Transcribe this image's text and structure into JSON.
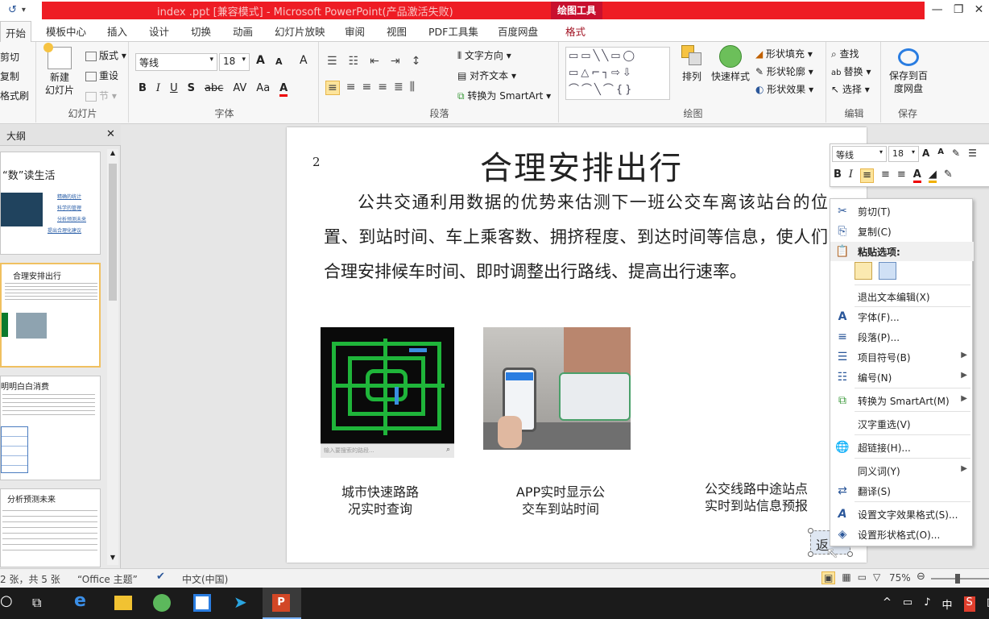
{
  "window": {
    "title": "index .ppt [兼容模式] - Microsoft PowerPoint(产品激活失败)",
    "tools_context": "绘图工具",
    "min": "—",
    "restore": "❐",
    "close": "✕"
  },
  "tabs": [
    "开始",
    "模板中心",
    "插入",
    "设计",
    "切换",
    "动画",
    "幻灯片放映",
    "审阅",
    "视图",
    "PDF工具集",
    "百度网盘",
    "格式"
  ],
  "ribbon": {
    "clipboard": {
      "cut": "剪切",
      "copy": "复制",
      "format_painter": "格式刷"
    },
    "slides": {
      "new_slide": "新建\n幻灯片",
      "layout": "版式",
      "reset": "重设",
      "section": "节",
      "label": "幻灯片"
    },
    "font": {
      "name": "等线",
      "size": "18",
      "label": "字体",
      "grow": "A",
      "shrink": "A",
      "clear": "A"
    },
    "paragraph": {
      "text_direction": "文字方向",
      "align_text": "对齐文本",
      "smartart": "转换为 SmartArt",
      "label": "段落"
    },
    "drawing": {
      "arrange": "排列",
      "quick_styles": "快速样式",
      "shape_fill": "形状填充",
      "shape_outline": "形状轮廓",
      "shape_effects": "形状效果",
      "label": "绘图"
    },
    "editing": {
      "find": "查找",
      "replace": "替换",
      "select": "选择",
      "label": "编辑"
    },
    "save": {
      "save_to_baidu": "保存到百\n度网盘",
      "label": "保存"
    }
  },
  "outline": {
    "tab_outline": "大纲",
    "close": "✕",
    "thumbs": [
      {
        "title": "“数”读生活",
        "lines": [
          "精确的统计",
          "科学的管理",
          "分析预测未来",
          "提出合理化建议"
        ]
      },
      {
        "title": "合理安排出行"
      },
      {
        "title": "明明白白消费"
      },
      {
        "title": "分析预测未来"
      }
    ]
  },
  "slide": {
    "number": "2",
    "title": "合理安排出行",
    "body": "公共交通利用数据的优势来估测下一班公交车离该站台的位置、到站时间、车上乘客数、拥挤程度、到达时间等信息，使人们合理安排候车时间、即时调整出行路线、提高出行速率。",
    "map_search_placeholder": "输入要搜索的路段...",
    "caption1": "城市快速路路\n况实时查询",
    "caption2": "APP实时显示公\n交车到站时间",
    "caption3": "公交线路中途站点\n实时到站信息预报",
    "back_button": "返"
  },
  "mini_toolbar": {
    "font": "等线",
    "size": "18"
  },
  "context_menu": {
    "items": [
      {
        "icon": "scissors-icon",
        "glyph": "✂",
        "label": "剪切(T)"
      },
      {
        "icon": "copy-icon",
        "glyph": "⎘",
        "label": "复制(C)"
      },
      {
        "icon": "paste-icon",
        "glyph": "📋",
        "label": "粘贴选项:"
      },
      {
        "label": "退出文本编辑(X)"
      },
      {
        "icon": "font-icon",
        "glyph": "A",
        "label": "字体(F)..."
      },
      {
        "icon": "paragraph-icon",
        "glyph": "≡",
        "label": "段落(P)..."
      },
      {
        "icon": "bullets-icon",
        "glyph": "☰",
        "label": "项目符号(B)"
      },
      {
        "icon": "numbering-icon",
        "glyph": "☷",
        "label": "编号(N)"
      },
      {
        "icon": "smartart-icon",
        "glyph": "⧉",
        "label": "转换为 SmartArt(M)"
      },
      {
        "label": "汉字重选(V)"
      },
      {
        "icon": "hyperlink-icon",
        "glyph": "🌐",
        "label": "超链接(H)..."
      },
      {
        "label": "同义词(Y)"
      },
      {
        "icon": "translate-icon",
        "glyph": "⇄",
        "label": "翻译(S)"
      },
      {
        "icon": "text-effects-icon",
        "glyph": "A",
        "label": "设置文字效果格式(S)..."
      },
      {
        "icon": "shape-format-icon",
        "glyph": "◈",
        "label": "设置形状格式(O)..."
      }
    ]
  },
  "status": {
    "slide_info": "2 张，共 5 张",
    "theme": "“Office 主题”",
    "language": "中文(中国)",
    "zoom": "75%"
  },
  "taskbar": {
    "ime": "中"
  }
}
